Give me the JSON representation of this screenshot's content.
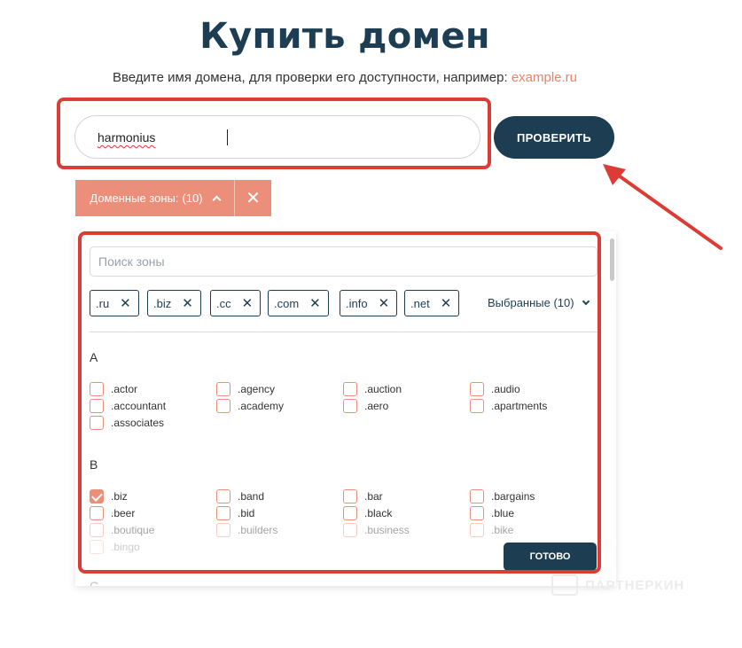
{
  "header": {
    "title": "Купить домен",
    "subtitle": "Введите имя домена, для проверки его доступности, например:",
    "example_link": "example.ru"
  },
  "search": {
    "value": "harmonius",
    "button_label": "ПРОВЕРИТЬ"
  },
  "zones_toggle": {
    "label": "Доменные зоны:",
    "count": "(10)"
  },
  "panel": {
    "search_placeholder": "Поиск зоны",
    "chips": [
      ".ru",
      ".biz",
      ".cc",
      ".com",
      ".info",
      ".net"
    ],
    "selected_label": "Выбранные (10)",
    "groups": [
      {
        "letter": "A",
        "items": [
          {
            "label": ".actor",
            "checked": false
          },
          {
            "label": ".agency",
            "checked": false
          },
          {
            "label": ".auction",
            "checked": false
          },
          {
            "label": ".audio",
            "checked": false
          },
          {
            "label": ".accountant",
            "checked": false
          },
          {
            "label": ".academy",
            "checked": false
          },
          {
            "label": ".aero",
            "checked": false
          },
          {
            "label": ".apartments",
            "checked": false
          },
          {
            "label": ".associates",
            "checked": false
          }
        ]
      },
      {
        "letter": "B",
        "items": [
          {
            "label": ".biz",
            "checked": true
          },
          {
            "label": ".band",
            "checked": false
          },
          {
            "label": ".bar",
            "checked": false
          },
          {
            "label": ".bargains",
            "checked": false
          },
          {
            "label": ".beer",
            "checked": false
          },
          {
            "label": ".bid",
            "checked": false
          },
          {
            "label": ".black",
            "checked": false
          },
          {
            "label": ".blue",
            "checked": false
          },
          {
            "label": ".boutique",
            "checked": false
          },
          {
            "label": ".builders",
            "checked": false
          },
          {
            "label": ".business",
            "checked": false
          },
          {
            "label": ".bike",
            "checked": false
          },
          {
            "label": ".bingo",
            "checked": false
          }
        ]
      },
      {
        "letter": "C",
        "items": []
      }
    ],
    "done_label": "ГОТОВО"
  },
  "watermark": "ПАРТНЕРКИН",
  "colors": {
    "brand_dark": "#1d3d52",
    "accent": "#ec8f7a",
    "highlight": "#dc3c36"
  }
}
